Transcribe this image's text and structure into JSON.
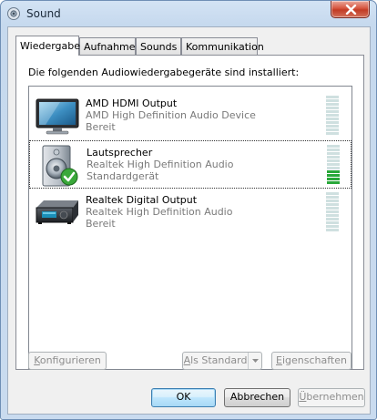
{
  "window": {
    "title": "Sound",
    "close_icon": "close-icon"
  },
  "tabs": [
    {
      "label": "Wiedergabe",
      "active": true
    },
    {
      "label": "Aufnahme",
      "active": false
    },
    {
      "label": "Sounds",
      "active": false
    },
    {
      "label": "Kommunikation",
      "active": false
    }
  ],
  "intro_text": "Die folgenden Audiowiedergabegeräte sind installiert:",
  "devices": [
    {
      "name": "AMD HDMI Output",
      "driver": "AMD High Definition Audio Device",
      "status": "Bereit",
      "icon": "hdmi-monitor-icon",
      "selected": false,
      "level_fraction": 0.0
    },
    {
      "name": "Lautsprecher",
      "driver": "Realtek High Definition Audio",
      "status": "Standardgerät",
      "icon": "speaker-icon",
      "default_badge": "default-checkmark-icon",
      "selected": true,
      "level_fraction": 0.4
    },
    {
      "name": "Realtek Digital Output",
      "driver": "Realtek High Definition Audio",
      "status": "Bereit",
      "icon": "digital-output-device-icon",
      "selected": false,
      "level_fraction": 0.0
    }
  ],
  "buttons": {
    "configure_prefix": "K",
    "configure_rest": "onfigurieren",
    "set_default_prefix": "A",
    "set_default_rest": "ls Standard",
    "properties_prefix": "E",
    "properties_rest": "igenschaften",
    "ok": "OK",
    "cancel": "Abbrechen",
    "apply_prefix": "Ü",
    "apply_rest": "bernehmen"
  },
  "colors": {
    "meter_on": "#29a83a",
    "meter_off": "#cfe0e0",
    "title_gradient_top": "#d3e3f4"
  }
}
